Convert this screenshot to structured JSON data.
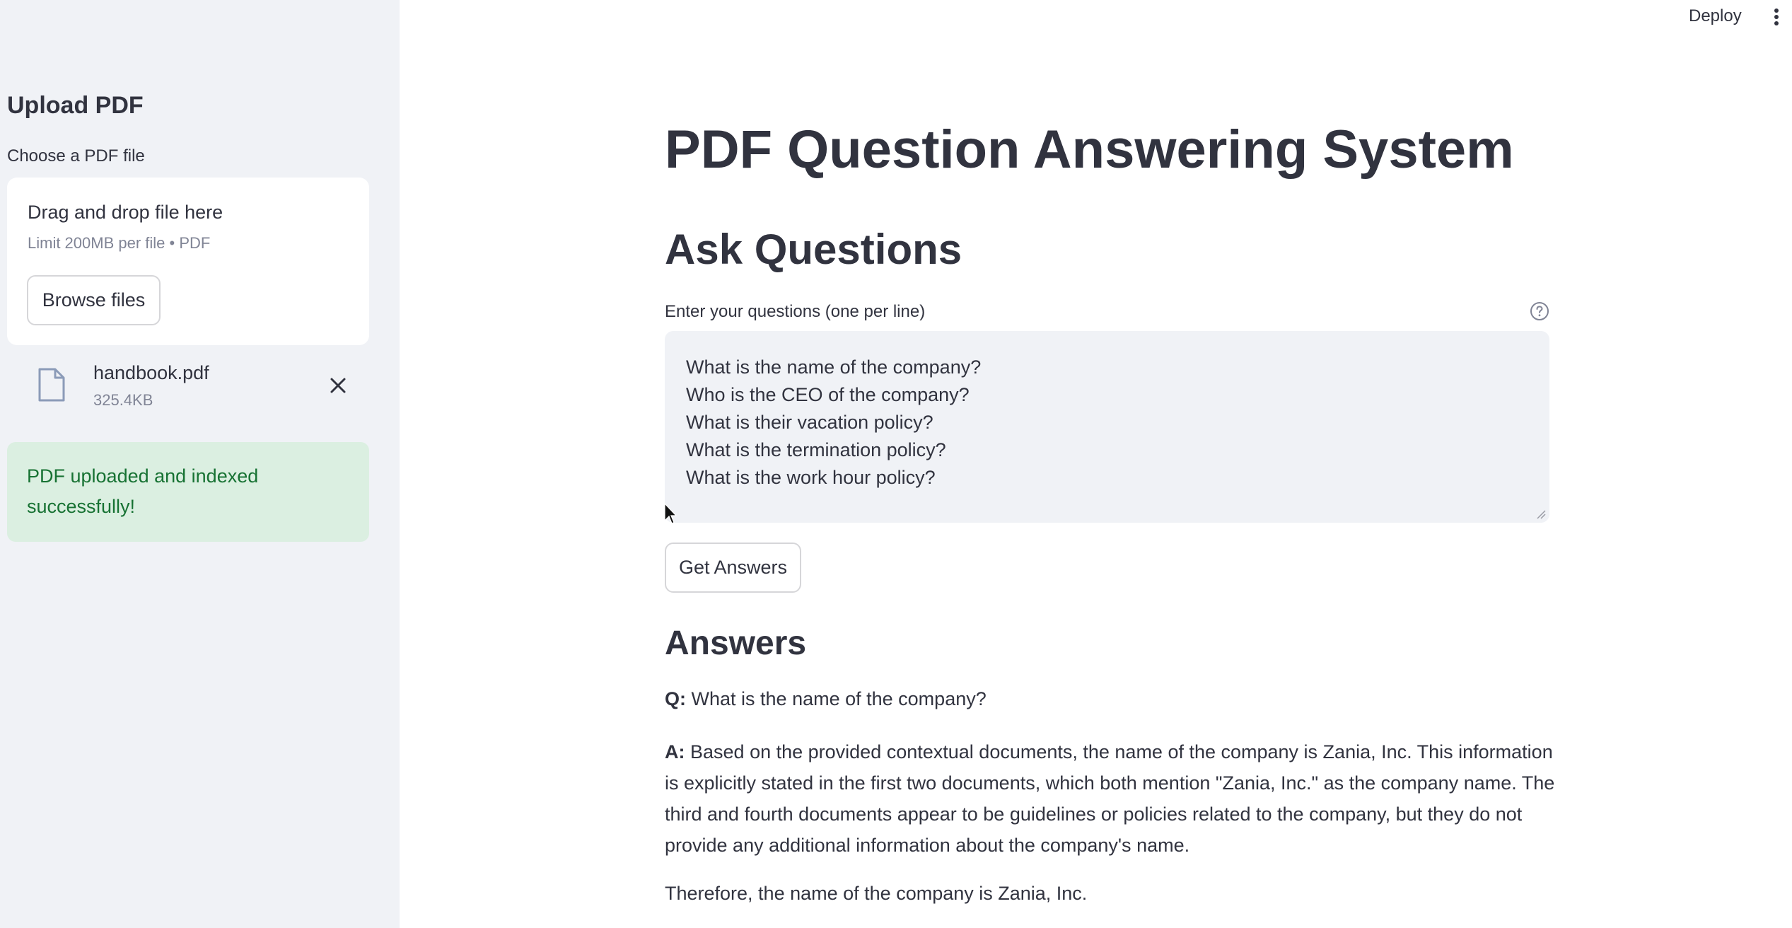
{
  "header": {
    "deploy_label": "Deploy",
    "menu_icon": "vertical-dots-icon"
  },
  "sidebar": {
    "heading": "Upload PDF",
    "uploader_label": "Choose a PDF file",
    "dropzone": {
      "title": "Drag and drop file here",
      "limit": "Limit 200MB per file • PDF",
      "browse_label": "Browse files"
    },
    "file": {
      "name": "handbook.pdf",
      "size": "325.4KB",
      "icon": "file-icon",
      "remove_icon": "close-icon"
    },
    "success_message": "PDF uploaded and indexed successfully!"
  },
  "main": {
    "title": "PDF Question Answering System",
    "subtitle": "Ask Questions",
    "questions_label": "Enter your questions (one per line)",
    "questions_value": "What is the name of the company?\nWho is the CEO of the company?\nWhat is their vacation policy?\nWhat is the termination policy?\nWhat is the work hour policy?",
    "get_answers_label": "Get Answers",
    "answers_heading": "Answers",
    "answers": [
      {
        "q_prefix": "Q:",
        "question": "What is the name of the company?",
        "a_prefix": "A:",
        "answer": "Based on the provided contextual documents, the name of the company is Zania, Inc. This information is explicitly stated in the first two documents, which both mention \"Zania, Inc.\" as the company name. The third and fourth documents appear to be guidelines or policies related to the company, but they do not provide any additional information about the company's name.",
        "conclusion": "Therefore, the name of the company is Zania, Inc."
      }
    ]
  },
  "colors": {
    "sidebar_bg": "#f0f2f6",
    "success_bg": "#dbefe1",
    "success_text": "#177233",
    "text": "#31333f",
    "muted": "#808495"
  }
}
